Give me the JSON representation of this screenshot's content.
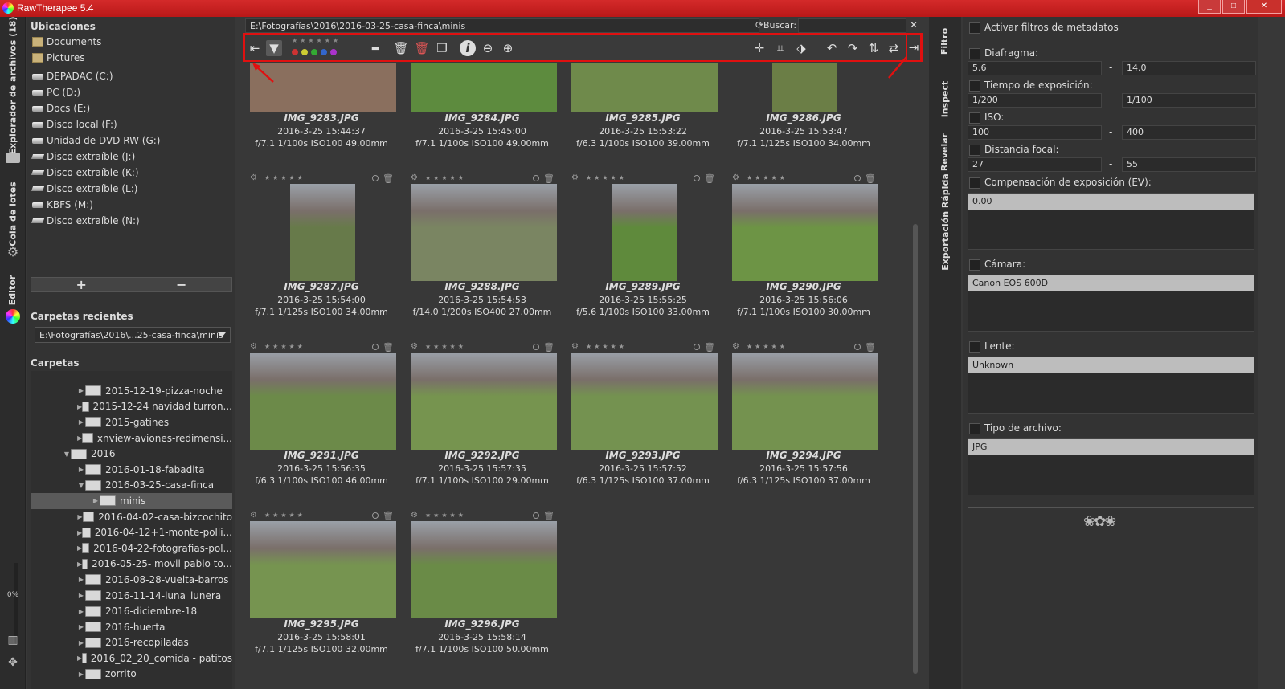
{
  "window": {
    "title": "RawTherapee 5.4",
    "buttons": [
      "_",
      "□",
      "✕"
    ]
  },
  "left_tabs": [
    "Explorador de archivos (18)",
    "Cola de lotes",
    "Editor"
  ],
  "left_bottom": {
    "progress": "0%"
  },
  "locations": {
    "title": "Ubicaciones",
    "items": [
      {
        "label": "Documents",
        "icon": "folder-icon"
      },
      {
        "label": "Pictures",
        "icon": "folder-icon"
      },
      {
        "label": "DEPADAC (C:)",
        "icon": "drive-icon"
      },
      {
        "label": "PC (D:)",
        "icon": "drive-icon"
      },
      {
        "label": "Docs (E:)",
        "icon": "drive-icon"
      },
      {
        "label": "Disco local (F:)",
        "icon": "drive-icon"
      },
      {
        "label": "Unidad de DVD RW (G:)",
        "icon": "dvd-icon"
      },
      {
        "label": "Disco extraíble (J:)",
        "icon": "usb-icon"
      },
      {
        "label": "Disco extraíble (K:)",
        "icon": "usb-icon"
      },
      {
        "label": "Disco extraíble (L:)",
        "icon": "usb-icon"
      },
      {
        "label": "KBFS (M:)",
        "icon": "drive-icon"
      },
      {
        "label": "Disco extraíble (N:)",
        "icon": "usb-icon"
      }
    ],
    "add": "+",
    "remove": "−"
  },
  "recent": {
    "title": "Carpetas recientes",
    "value": "E:\\Fotografías\\2016\\...25-casa-finca\\minis"
  },
  "folders": {
    "title": "Carpetas",
    "items": [
      {
        "label": "2015-12-19-pizza-noche",
        "depth": 1,
        "exp": "▶"
      },
      {
        "label": "2015-12-24 navidad turron...",
        "depth": 1,
        "exp": "▶"
      },
      {
        "label": "2015-gatines",
        "depth": 1,
        "exp": "▶"
      },
      {
        "label": "xnview-aviones-redimensi...",
        "depth": 1,
        "exp": "▶"
      },
      {
        "label": "2016",
        "depth": 0,
        "exp": "▼"
      },
      {
        "label": "2016-01-18-fabadita",
        "depth": 1,
        "exp": "▶"
      },
      {
        "label": "2016-03-25-casa-finca",
        "depth": 1,
        "exp": "▼"
      },
      {
        "label": "minis",
        "depth": 2,
        "exp": "▶",
        "selected": true
      },
      {
        "label": "2016-04-02-casa-bizcochito",
        "depth": 1,
        "exp": "▶"
      },
      {
        "label": "2016-04-12+1-monte-polli...",
        "depth": 1,
        "exp": "▶"
      },
      {
        "label": "2016-04-22-fotografias-pol...",
        "depth": 1,
        "exp": "▶"
      },
      {
        "label": "2016-05-25- movil pablo to...",
        "depth": 1,
        "exp": "▶"
      },
      {
        "label": "2016-08-28-vuelta-barros",
        "depth": 1,
        "exp": "▶"
      },
      {
        "label": "2016-11-14-luna_lunera",
        "depth": 1,
        "exp": "▶"
      },
      {
        "label": "2016-diciembre-18",
        "depth": 1,
        "exp": "▶"
      },
      {
        "label": "2016-huerta",
        "depth": 1,
        "exp": "▶"
      },
      {
        "label": "2016-recopiladas",
        "depth": 1,
        "exp": "▶"
      },
      {
        "label": "2016_02_20_comida - patitos",
        "depth": 1,
        "exp": "▶"
      },
      {
        "label": "zorrito",
        "depth": 1,
        "exp": "▶"
      }
    ]
  },
  "path": "E:\\Fotografías\\2016\\2016-03-25-casa-finca\\minis",
  "search": {
    "label": "Buscar:",
    "value": ""
  },
  "toolbar": {
    "icons": [
      "collapse-left-icon",
      "filter-icon",
      "star-rating-icon",
      "color-label-icon",
      "trash-icon",
      "delete-icon",
      "copy-icon",
      "info-icon",
      "zoom-out-icon",
      "zoom-in-icon",
      "crosshair-icon",
      "crop-icon",
      "transform-icon",
      "rotate-left-icon",
      "rotate-right-icon",
      "flip-vertical-icon",
      "flip-horizontal-icon",
      "collapse-right-icon"
    ],
    "color_dots": [
      "#c33",
      "#cc3",
      "#3a3",
      "#36c",
      "#a3c"
    ]
  },
  "thumbnails": [
    {
      "name": "IMG_9283.JPG",
      "date": "2016-3-25 15:44:37",
      "exif": "f/7.1 1/100s ISO100 49.00mm",
      "color": "#8a6f5e"
    },
    {
      "name": "IMG_9284.JPG",
      "date": "2016-3-25 15:45:00",
      "exif": "f/7.1 1/100s ISO100 49.00mm",
      "color": "#5d8b3e"
    },
    {
      "name": "IMG_9285.JPG",
      "date": "2016-3-25 15:53:22",
      "exif": "f/6.3 1/100s ISO100 39.00mm",
      "color": "#6f8a4b"
    },
    {
      "name": "IMG_9286.JPG",
      "date": "2016-3-25 15:53:47",
      "exif": "f/7.1 1/125s ISO100 34.00mm",
      "color": "#6b7e46"
    },
    {
      "name": "IMG_9287.JPG",
      "date": "2016-3-25 15:54:00",
      "exif": "f/7.1 1/125s ISO100 34.00mm",
      "color": "#677a4a"
    },
    {
      "name": "IMG_9288.JPG",
      "date": "2016-3-25 15:54:53",
      "exif": "f/14.0 1/200s ISO400 27.00mm",
      "color": "#7a8562"
    },
    {
      "name": "IMG_9289.JPG",
      "date": "2016-3-25 15:55:25",
      "exif": "f/5.6 1/100s ISO100 33.00mm",
      "color": "#5f8a3c"
    },
    {
      "name": "IMG_9290.JPG",
      "date": "2016-3-25 15:56:06",
      "exif": "f/7.1 1/100s ISO100 30.00mm",
      "color": "#6d9445"
    },
    {
      "name": "IMG_9291.JPG",
      "date": "2016-3-25 15:56:35",
      "exif": "f/6.3 1/100s ISO100 46.00mm",
      "color": "#6c8a49"
    },
    {
      "name": "IMG_9292.JPG",
      "date": "2016-3-25 15:57:35",
      "exif": "f/7.1 1/100s ISO100 29.00mm",
      "color": "#76944f"
    },
    {
      "name": "IMG_9293.JPG",
      "date": "2016-3-25 15:57:52",
      "exif": "f/6.3 1/125s ISO100 37.00mm",
      "color": "#749250"
    },
    {
      "name": "IMG_9294.JPG",
      "date": "2016-3-25 15:57:56",
      "exif": "f/6.3 1/125s ISO100 37.00mm",
      "color": "#74924f"
    },
    {
      "name": "IMG_9295.JPG",
      "date": "2016-3-25 15:58:01",
      "exif": "f/7.1 1/125s ISO100 32.00mm",
      "color": "#769450"
    },
    {
      "name": "IMG_9296.JPG",
      "date": "2016-3-25 15:58:14",
      "exif": "f/7.1 1/100s ISO100 50.00mm",
      "color": "#6a8b47"
    }
  ],
  "side_tabs": [
    "Filtro",
    "Inspect",
    "Revelar",
    "Exportación Rápida"
  ],
  "filter": {
    "activate": "Activar filtros de metadatos",
    "aperture": {
      "label": "Diafragma:",
      "from": "5.6",
      "to": "14.0"
    },
    "shutter": {
      "label": "Tiempo de exposición:",
      "from": "1/200",
      "to": "1/100"
    },
    "iso": {
      "label": "ISO:",
      "from": "100",
      "to": "400"
    },
    "focal": {
      "label": "Distancia focal:",
      "from": "27",
      "to": "55"
    },
    "expcomp": {
      "label": "Compensación de exposición (EV):",
      "value": "0.00"
    },
    "camera": {
      "label": "Cámara:",
      "value": "Canon EOS 600D"
    },
    "lens": {
      "label": "Lente:",
      "value": "Unknown"
    },
    "filetype": {
      "label": "Tipo de archivo:",
      "value": "JPG"
    }
  }
}
